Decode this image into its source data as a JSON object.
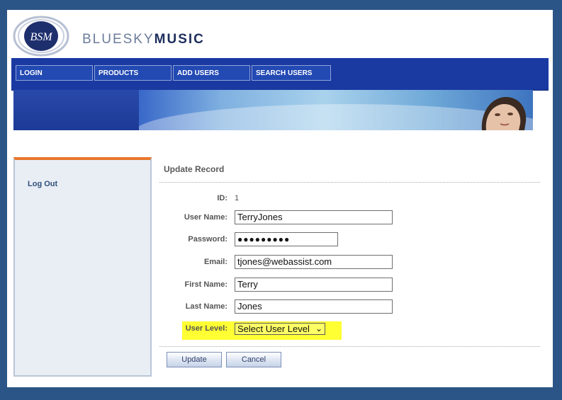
{
  "logo": {
    "mark_text": "BSM",
    "brand_light": "BLUESKY",
    "brand_bold": "MUSIC"
  },
  "nav": [
    {
      "label": "LOGIN"
    },
    {
      "label": "PRODUCTS"
    },
    {
      "label": "ADD USERS"
    },
    {
      "label": "SEARCH USERS"
    }
  ],
  "sidebar": {
    "logout_label": "Log Out"
  },
  "form": {
    "title": "Update Record",
    "id_label": "ID:",
    "id_value": "1",
    "username_label": "User Name:",
    "username_value": "TerryJones",
    "password_label": "Password:",
    "password_value": "●●●●●●●●●",
    "email_label": "Email:",
    "email_value": "tjones@webassist.com",
    "firstname_label": "First Name:",
    "firstname_value": "Terry",
    "lastname_label": "Last Name:",
    "lastname_value": "Jones",
    "userlevel_label": "User Level:",
    "userlevel_value": "Select User Level",
    "update_label": "Update",
    "cancel_label": "Cancel"
  },
  "colors": {
    "outer_bg": "#2b5586",
    "nav_bg": "#1a3aa2",
    "sidebar_accent": "#e8762b",
    "highlight": "#ffff33"
  }
}
